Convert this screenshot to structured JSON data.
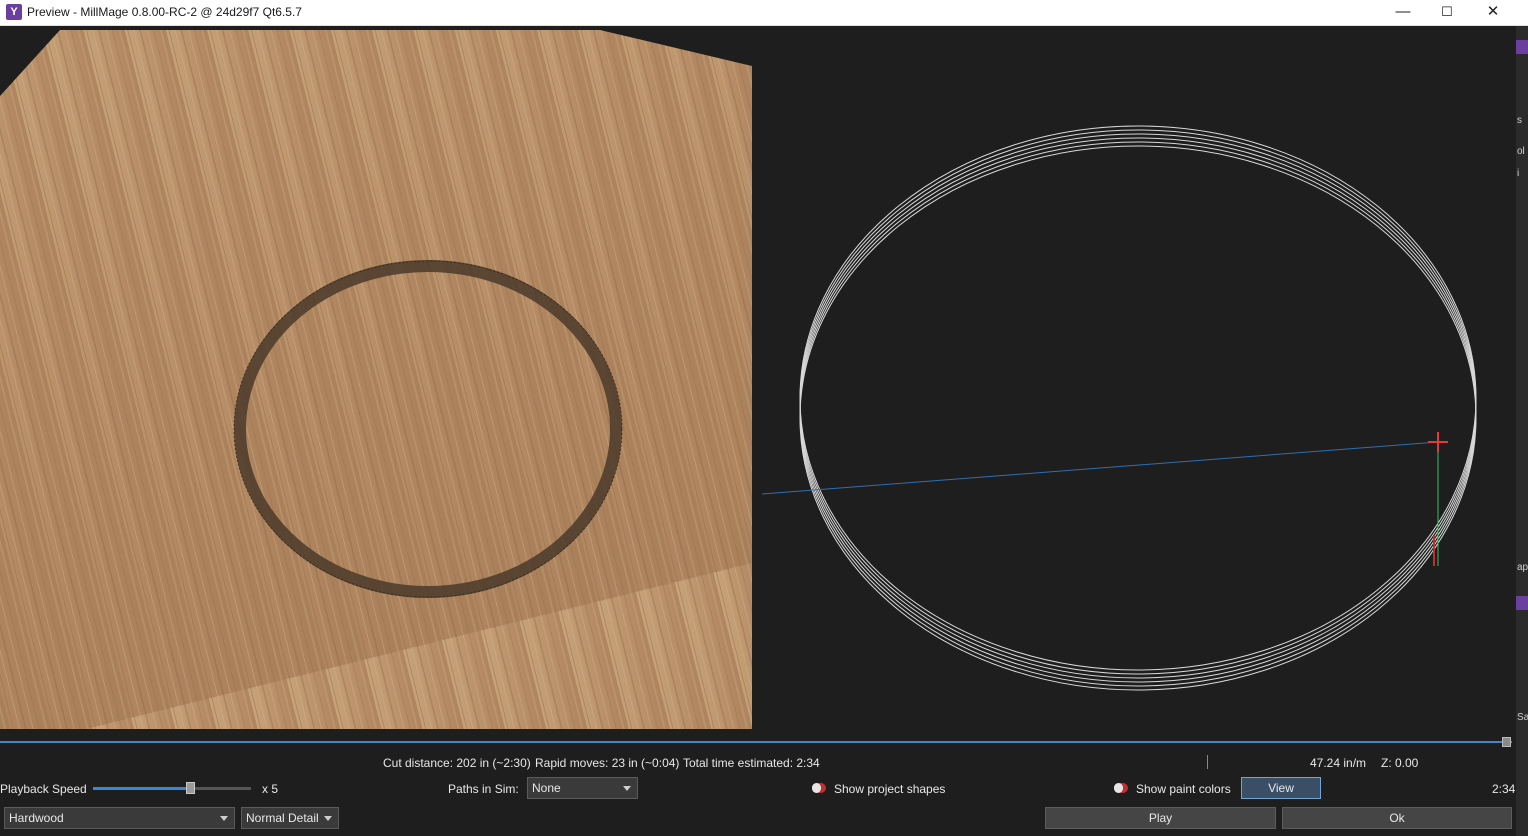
{
  "window": {
    "title": "Preview - MillMage 0.8.00-RC-2 @ 24d29f7 Qt6.5.7",
    "minimize": "—",
    "maximize": "☐",
    "close": "✕"
  },
  "stats": {
    "cut_distance": "Cut distance: 202 in (~2:30)",
    "rapid_moves": "Rapid moves: 23 in (~0:04)",
    "total_time": "Total time estimated: 2:34",
    "feed_rate": "47.24 in/m",
    "z_value": "Z: 0.00"
  },
  "playback": {
    "label": "Playback Speed",
    "multiplier": "x 5",
    "slider_fraction": 0.62,
    "time": "2:34"
  },
  "paths_in_sim": {
    "label": "Paths in Sim:",
    "value": "None"
  },
  "toggles": {
    "show_project_shapes": "Show project shapes",
    "show_paint_colors": "Show paint colors"
  },
  "buttons": {
    "view": "View",
    "play": "Play",
    "ok": "Ok"
  },
  "material": {
    "value": "Hardwood"
  },
  "detail": {
    "value": "Normal Detail"
  },
  "right_strip": {
    "t1": "s",
    "t2": "ol",
    "t3": "i",
    "t4": "ap",
    "t5": "Sa"
  },
  "colors": {
    "accent": "#3a86d8",
    "brand_purple": "#6b3fa0",
    "toggle_red": "#c03030"
  }
}
